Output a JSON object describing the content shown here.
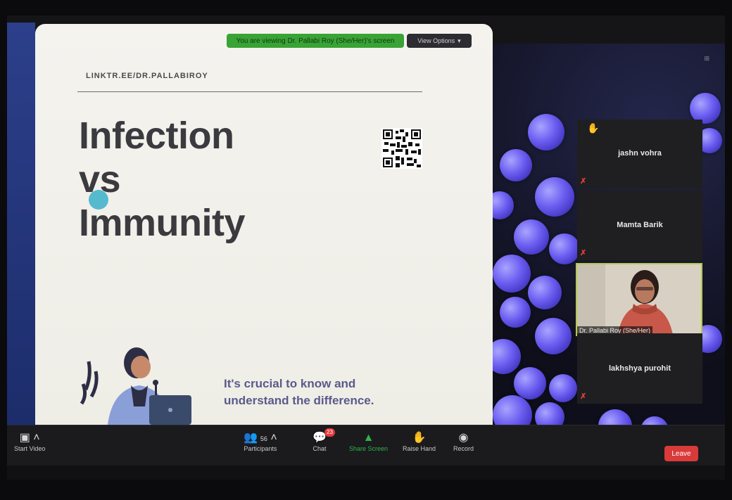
{
  "slide": {
    "link": "LINKTR.EE/DR.PALLABIROY",
    "title_lines": [
      "Infection",
      "vs",
      "Immunity"
    ],
    "caption_line1": "It's crucial to know and",
    "caption_line2": "understand the difference."
  },
  "share_banner": {
    "text": "You are viewing Dr. Pallabi Roy (She/Her)'s screen"
  },
  "view_options": {
    "label": "View Options"
  },
  "participants_panel": {
    "tiles": [
      {
        "name": "jashn vohra",
        "raised_hand": true
      },
      {
        "name": "Mamta Barik",
        "raised_hand": false
      },
      {
        "name": "lakhshya purohit",
        "raised_hand": false
      }
    ],
    "video_tile": {
      "label": "Dr. Pallabi Roy (She/Her)"
    }
  },
  "toolbar": {
    "start_video": "Start Video",
    "participants": "Participants",
    "participants_count": "56",
    "chat": "Chat",
    "chat_badge": "23",
    "share_screen": "Share Screen",
    "raise_hand": "Raise Hand",
    "record": "Record",
    "leave": "Leave"
  },
  "icons": {
    "video": "video-off-icon",
    "participants": "people-icon",
    "chat": "chat-icon",
    "share": "share-screen-icon",
    "hand": "raise-hand-icon",
    "record": "record-icon"
  },
  "colors": {
    "share_green": "#2fb24a",
    "leave_red": "#d93a3a",
    "active_speaker_border": "#b7c94a"
  }
}
